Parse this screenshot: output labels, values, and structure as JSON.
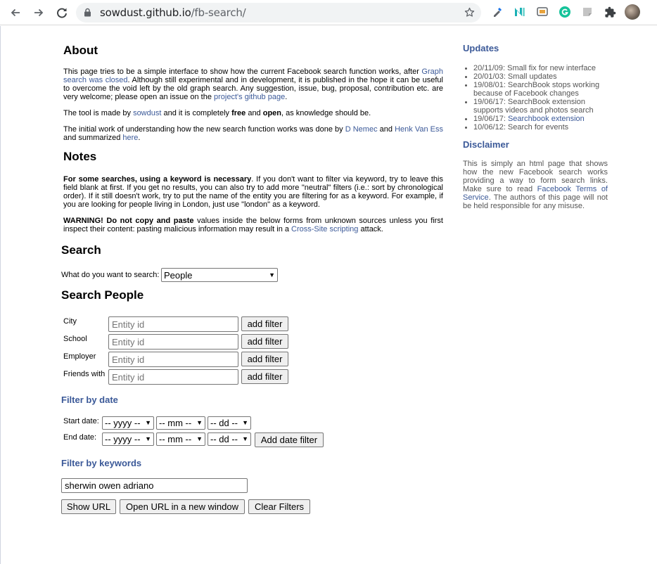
{
  "browser": {
    "url_host": "sowdust.github.io",
    "url_path": "/fb-search/"
  },
  "about": {
    "title": "About",
    "p1_a": "This page tries to be a simple interface to show how the current Facebook search function works, after ",
    "p1_link1": "Graph search was closed",
    "p1_b": ". Although still experimental and in development, it is published in the hope it can be useful to overcome the void left by the old graph search. Any suggestion, issue, bug, proposal, contribution etc. are very welcome; please open an issue on the ",
    "p1_link2": "project's github page",
    "p1_c": ".",
    "p2_a": "The tool is made by ",
    "p2_link": "sowdust",
    "p2_b": " and it is completely ",
    "p2_free": "free",
    "p2_c": " and ",
    "p2_open": "open",
    "p2_d": ", as knowledge should be.",
    "p3_a": "The initial work of understanding how the new search function works was done by ",
    "p3_link1": "D Nemec",
    "p3_b": " and ",
    "p3_link2": "Henk Van Ess",
    "p3_c": " and summarized ",
    "p3_link3": "here",
    "p3_d": "."
  },
  "notes": {
    "title": "Notes",
    "p1_bold": "For some searches, using a keyword is necessary",
    "p1_rest": ". If you don't want to filter via keyword, try to leave this field blank at first. If you get no results, you can also try to add more \"neutral\" filters (i.e.: sort by chronological order). If it still doesn't work, try to put the name of the entity you are filtering for as a keyword. For example, if you are looking for people living in London, just use \"london\" as a keyword.",
    "p2_bold": "WARNING! Do not copy and paste",
    "p2_a": " values inside the below forms from unknown sources unless you first inspect their content: pasting malicious information may result in a ",
    "p2_link": "Cross-Site scripting",
    "p2_b": " attack."
  },
  "search": {
    "title": "Search",
    "question": "What do you want to search:",
    "selected": "People"
  },
  "search_people": {
    "title": "Search People",
    "rows": [
      {
        "label": "City",
        "placeholder": "Entity id",
        "button": "add filter"
      },
      {
        "label": "School",
        "placeholder": "Entity id",
        "button": "add filter"
      },
      {
        "label": "Employer",
        "placeholder": "Entity id",
        "button": "add filter"
      },
      {
        "label": "Friends with",
        "placeholder": "Entity id",
        "button": "add filter"
      }
    ]
  },
  "filter_date": {
    "title": "Filter by date",
    "start_label": "Start date:",
    "end_label": "End date:",
    "yyyy": "-- yyyy --",
    "mm": "-- mm --",
    "dd": "-- dd --",
    "add_button": "Add date filter"
  },
  "filter_keywords": {
    "title": "Filter by keywords",
    "value": "sherwin owen adriano"
  },
  "actions": {
    "show_url": "Show URL",
    "open_url": "Open URL in a new window",
    "clear": "Clear Filters"
  },
  "updates": {
    "title": "Updates",
    "items": [
      {
        "text": "20/11/09: Small fix for new interface",
        "link": ""
      },
      {
        "text": "20/01/03: Small updates",
        "link": ""
      },
      {
        "text": "19/08/01: SearchBook stops working because of Facebook changes",
        "link": ""
      },
      {
        "text": "19/06/17: SearchBook extension supports videos and photos search",
        "link": ""
      },
      {
        "text": "19/06/17: ",
        "link": "Searchbook extension"
      },
      {
        "text": "10/06/12: Search for events",
        "link": ""
      }
    ]
  },
  "disclaimer": {
    "title": "Disclaimer",
    "text_a": "This is simply an html page that shows how the new Facebook search works providing a way to form search links. Make sure to read ",
    "link": "Facebook Terms of Service",
    "text_b": ". The authors of this page will not be held responsible for any misuse."
  },
  "colors": {
    "link": "#3b5998",
    "omnibox_bg": "#f1f3f4",
    "button_bg": "#efefef"
  }
}
